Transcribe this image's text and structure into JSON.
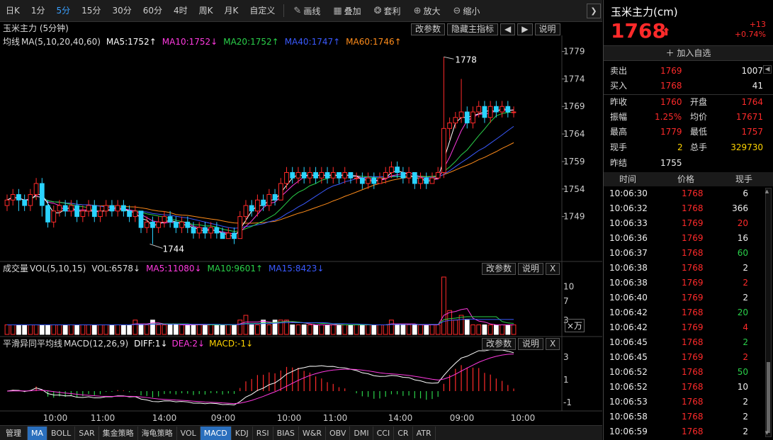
{
  "toolbar": {
    "periods": [
      "日K",
      "1分",
      "5分",
      "15分",
      "30分",
      "60分",
      "4时",
      "周K",
      "月K",
      "自定义"
    ],
    "active_period": "5分",
    "tools": [
      {
        "icon": "pencil-icon",
        "label": "画线"
      },
      {
        "icon": "overlay-icon",
        "label": "叠加"
      },
      {
        "icon": "money-bag-icon",
        "label": "套利"
      },
      {
        "icon": "zoom-in-icon",
        "label": "放大"
      },
      {
        "icon": "zoom-out-icon",
        "label": "缩小"
      }
    ],
    "collapse_glyph": "❯"
  },
  "main_panel": {
    "title": "玉米主力 (5分钟)",
    "buttons": [
      "改参数",
      "隐藏主指标",
      "◀",
      "▶",
      "说明"
    ],
    "ma_label": "均线",
    "ma_params": "MA(5,10,20,40,60)",
    "ma_values": [
      {
        "text": "MA5:1752↑",
        "color": "#ffffff"
      },
      {
        "text": "MA10:1752↓",
        "color": "#ff3ae0"
      },
      {
        "text": "MA20:1752↑",
        "color": "#2ad14a"
      },
      {
        "text": "MA40:1747↑",
        "color": "#3a5aff"
      },
      {
        "text": "MA60:1746↑",
        "color": "#ff8c1a"
      }
    ],
    "y_ticks": [
      "1779",
      "1774",
      "1769",
      "1764",
      "1759",
      "1754",
      "1749"
    ],
    "high_label": "1778",
    "low_label": "1744"
  },
  "volume_panel": {
    "label": "成交量",
    "params": "VOL(5,10,15)",
    "values": [
      {
        "text": "VOL:6578↓",
        "color": "#dddddd"
      },
      {
        "text": "MA5:11080↓",
        "color": "#ff3ae0"
      },
      {
        "text": "MA10:9601↑",
        "color": "#2ad14a"
      },
      {
        "text": "MA15:8423↓",
        "color": "#3a5aff"
      }
    ],
    "buttons": [
      "改参数",
      "说明",
      "X"
    ],
    "y_ticks": [
      "10",
      "7",
      "3"
    ],
    "unit": "×万"
  },
  "macd_panel": {
    "label": "平滑异同平均线",
    "params": "MACD(12,26,9)",
    "values": [
      {
        "text": "DIFF:1↓",
        "color": "#ffffff"
      },
      {
        "text": "DEA:2↓",
        "color": "#ff3ae0"
      },
      {
        "text": "MACD:-1↓",
        "color": "#ffd400"
      }
    ],
    "buttons": [
      "改参数",
      "说明",
      "X"
    ],
    "y_ticks": [
      "3",
      "1",
      "-1"
    ]
  },
  "x_axis_labels": [
    "10:00",
    "11:00",
    "14:00",
    "09:00",
    "10:00",
    "11:00",
    "14:00",
    "09:00",
    "10:00"
  ],
  "bottom_tabs": [
    "管理",
    "MA",
    "BOLL",
    "SAR",
    "集金策略",
    "海龟策略",
    "VOL",
    "MACD",
    "KDJ",
    "RSI",
    "BIAS",
    "W&R",
    "OBV",
    "DMI",
    "CCI",
    "CR",
    "ATR"
  ],
  "active_tabs": [
    "MA",
    "MACD"
  ],
  "quote": {
    "name": "玉米主力(cm)",
    "price": "1768",
    "arrow": "⬆",
    "change": "+13",
    "change_pct": "+0.74%",
    "add_favorite": "加入自选",
    "sell_label": "卖出",
    "sell_price": "1769",
    "sell_vol": "1007",
    "buy_label": "买入",
    "buy_price": "1768",
    "buy_vol": "41",
    "prev_close_label": "昨收",
    "prev_close": "1760",
    "open_label": "开盘",
    "open": "1764",
    "amp_label": "振幅",
    "amp": "1.25%",
    "avg_label": "均价",
    "avg": "17671",
    "high_label": "最高",
    "high": "1779",
    "low_label": "最低",
    "low": "1757",
    "cur_vol_label": "现手",
    "cur_vol": "2",
    "total_vol_label": "总手",
    "total_vol": "329730",
    "settle_label": "昨结",
    "settle": "1755"
  },
  "ticks": {
    "headers": [
      "时间",
      "价格",
      "现手"
    ],
    "rows": [
      {
        "time": "10:06:30",
        "price": "1768",
        "vol": "6",
        "vc": "white"
      },
      {
        "time": "10:06:32",
        "price": "1768",
        "vol": "366",
        "vc": "white"
      },
      {
        "time": "10:06:33",
        "price": "1769",
        "vol": "20",
        "vc": "red"
      },
      {
        "time": "10:06:36",
        "price": "1769",
        "vol": "16",
        "vc": "white"
      },
      {
        "time": "10:06:37",
        "price": "1768",
        "vol": "60",
        "vc": "green"
      },
      {
        "time": "10:06:38",
        "price": "1768",
        "vol": "2",
        "vc": "white"
      },
      {
        "time": "10:06:38",
        "price": "1769",
        "vol": "2",
        "vc": "red"
      },
      {
        "time": "10:06:40",
        "price": "1769",
        "vol": "2",
        "vc": "white"
      },
      {
        "time": "10:06:42",
        "price": "1768",
        "vol": "20",
        "vc": "green"
      },
      {
        "time": "10:06:42",
        "price": "1769",
        "vol": "4",
        "vc": "red"
      },
      {
        "time": "10:06:45",
        "price": "1768",
        "vol": "2",
        "vc": "green"
      },
      {
        "time": "10:06:45",
        "price": "1769",
        "vol": "2",
        "vc": "red"
      },
      {
        "time": "10:06:52",
        "price": "1768",
        "vol": "50",
        "vc": "green"
      },
      {
        "time": "10:06:52",
        "price": "1768",
        "vol": "10",
        "vc": "white"
      },
      {
        "time": "10:06:53",
        "price": "1768",
        "vol": "2",
        "vc": "white"
      },
      {
        "time": "10:06:58",
        "price": "1768",
        "vol": "2",
        "vc": "white"
      },
      {
        "time": "10:06:59",
        "price": "1768",
        "vol": "2",
        "vc": "white"
      }
    ]
  },
  "colors": {
    "up": "#ff2a2a",
    "down": "#2ad3ff",
    "ma5": "#ffffff",
    "ma10": "#ff3ae0",
    "ma20": "#2ad14a",
    "ma40": "#3a5aff",
    "ma60": "#ff8c1a",
    "macd_pos": "#ff2a2a",
    "macd_neg": "#2ad14a"
  },
  "chart_data": {
    "type": "candlestick",
    "title": "玉米主力 (5分钟)",
    "y_range": [
      1744,
      1779
    ],
    "candles": [
      [
        1751,
        1752,
        1753,
        1750
      ],
      [
        1752,
        1753,
        1754,
        1751
      ],
      [
        1753,
        1752,
        1754,
        1750
      ],
      [
        1752,
        1751,
        1753,
        1750
      ],
      [
        1751,
        1753,
        1754,
        1750
      ],
      [
        1753,
        1755,
        1756,
        1752
      ],
      [
        1755,
        1751,
        1756,
        1749
      ],
      [
        1751,
        1748,
        1752,
        1747
      ],
      [
        1748,
        1750,
        1751,
        1747
      ],
      [
        1750,
        1751,
        1752,
        1749
      ],
      [
        1751,
        1750,
        1752,
        1749
      ],
      [
        1750,
        1751,
        1752,
        1749
      ],
      [
        1751,
        1749,
        1752,
        1748
      ],
      [
        1749,
        1750,
        1751,
        1748
      ],
      [
        1750,
        1751,
        1752,
        1749
      ],
      [
        1751,
        1749,
        1752,
        1748
      ],
      [
        1749,
        1750,
        1751,
        1748
      ],
      [
        1750,
        1751,
        1752,
        1749
      ],
      [
        1751,
        1750,
        1752,
        1749
      ],
      [
        1750,
        1751,
        1752,
        1749
      ],
      [
        1751,
        1750,
        1752,
        1749
      ],
      [
        1750,
        1749,
        1751,
        1748
      ],
      [
        1749,
        1750,
        1751,
        1748
      ],
      [
        1750,
        1747,
        1750,
        1746
      ],
      [
        1747,
        1748,
        1749,
        1746
      ],
      [
        1748,
        1747,
        1749,
        1744
      ],
      [
        1747,
        1748,
        1749,
        1746
      ],
      [
        1748,
        1749,
        1750,
        1747
      ],
      [
        1749,
        1748,
        1750,
        1747
      ],
      [
        1748,
        1747,
        1749,
        1746
      ],
      [
        1747,
        1748,
        1749,
        1746
      ],
      [
        1748,
        1747,
        1749,
        1746
      ],
      [
        1747,
        1746,
        1748,
        1745
      ],
      [
        1746,
        1747,
        1748,
        1745
      ],
      [
        1747,
        1746,
        1748,
        1745
      ],
      [
        1746,
        1747,
        1748,
        1745
      ],
      [
        1747,
        1746,
        1748,
        1745
      ],
      [
        1746,
        1745,
        1747,
        1745
      ],
      [
        1745,
        1746,
        1747,
        1745
      ],
      [
        1746,
        1745,
        1747,
        1744
      ],
      [
        1745,
        1749,
        1750,
        1745
      ],
      [
        1749,
        1751,
        1752,
        1748
      ],
      [
        1751,
        1750,
        1752,
        1749
      ],
      [
        1750,
        1752,
        1753,
        1749
      ],
      [
        1752,
        1751,
        1753,
        1750
      ],
      [
        1751,
        1753,
        1754,
        1750
      ],
      [
        1753,
        1752,
        1754,
        1751
      ],
      [
        1752,
        1755,
        1756,
        1752
      ],
      [
        1755,
        1757,
        1758,
        1754
      ],
      [
        1757,
        1756,
        1758,
        1755
      ],
      [
        1756,
        1757,
        1758,
        1755
      ],
      [
        1757,
        1756,
        1758,
        1755
      ],
      [
        1756,
        1757,
        1758,
        1755
      ],
      [
        1757,
        1756,
        1758,
        1755
      ],
      [
        1756,
        1757,
        1758,
        1755
      ],
      [
        1757,
        1756,
        1758,
        1755
      ],
      [
        1756,
        1757,
        1758,
        1755
      ],
      [
        1757,
        1756,
        1757,
        1755
      ],
      [
        1756,
        1757,
        1758,
        1755
      ],
      [
        1757,
        1756,
        1757,
        1755
      ],
      [
        1756,
        1756,
        1757,
        1755
      ],
      [
        1756,
        1755,
        1757,
        1754
      ],
      [
        1755,
        1756,
        1757,
        1754
      ],
      [
        1756,
        1755,
        1757,
        1754
      ],
      [
        1755,
        1756,
        1757,
        1755
      ],
      [
        1756,
        1757,
        1758,
        1755
      ],
      [
        1757,
        1758,
        1759,
        1756
      ],
      [
        1758,
        1757,
        1759,
        1756
      ],
      [
        1757,
        1756,
        1758,
        1755
      ],
      [
        1756,
        1757,
        1758,
        1755
      ],
      [
        1757,
        1755,
        1757,
        1754
      ],
      [
        1755,
        1756,
        1757,
        1754
      ],
      [
        1756,
        1755,
        1757,
        1754
      ],
      [
        1755,
        1756,
        1757,
        1755
      ],
      [
        1756,
        1757,
        1758,
        1756
      ],
      [
        1757,
        1765,
        1778,
        1756
      ],
      [
        1765,
        1766,
        1767,
        1763
      ],
      [
        1766,
        1767,
        1768,
        1765
      ],
      [
        1767,
        1768,
        1774,
        1766
      ],
      [
        1768,
        1766,
        1769,
        1765
      ],
      [
        1766,
        1768,
        1769,
        1765
      ],
      [
        1768,
        1769,
        1770,
        1767
      ],
      [
        1769,
        1767,
        1770,
        1766
      ],
      [
        1767,
        1769,
        1770,
        1766
      ],
      [
        1769,
        1768,
        1770,
        1767
      ],
      [
        1768,
        1769,
        1770,
        1767
      ],
      [
        1769,
        1768,
        1770,
        1767
      ],
      [
        1768,
        1768,
        1769,
        1767
      ]
    ],
    "volume": [
      2,
      2,
      2,
      2,
      2,
      2,
      2,
      2,
      2,
      2,
      2,
      2,
      2,
      2,
      2,
      2,
      2,
      2,
      2,
      2,
      2,
      2,
      3,
      2,
      2,
      3,
      2,
      2,
      2,
      2,
      2,
      2,
      2,
      2,
      2,
      2,
      2,
      2,
      2,
      2,
      3,
      4,
      2,
      2,
      3,
      2,
      3,
      3,
      3,
      2,
      2,
      2,
      2,
      2,
      2,
      2,
      2,
      2,
      2,
      2,
      2,
      2,
      2,
      2,
      2,
      2,
      3,
      2,
      2,
      2,
      2,
      2,
      2,
      2,
      2,
      12,
      5,
      3,
      4,
      3,
      2,
      2,
      2,
      2,
      2,
      2,
      2,
      2
    ],
    "macd_range": [
      -1.5,
      3.5
    ]
  }
}
